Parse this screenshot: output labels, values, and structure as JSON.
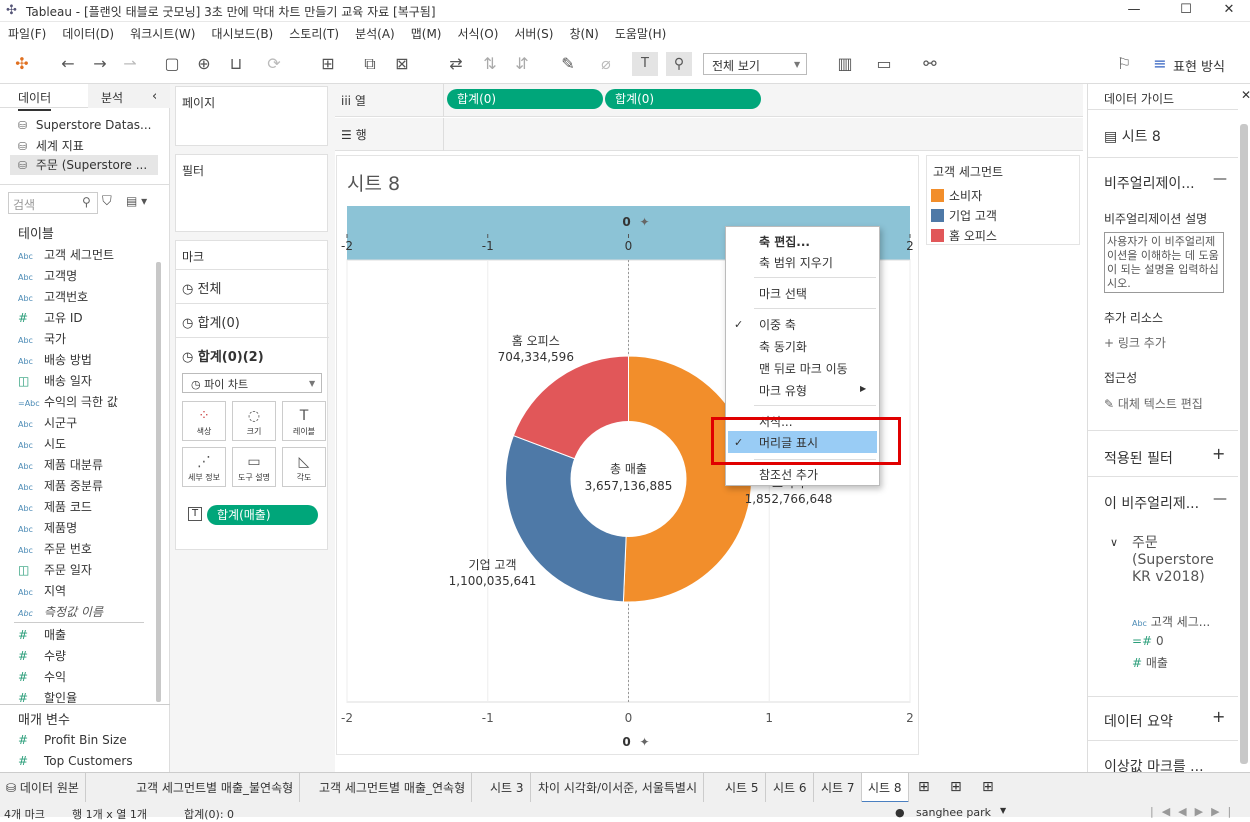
{
  "window": {
    "title": "Tableau - [플랜잇 태블로 굿모닝] 3초 만에 막대 차트 만들기 교육 자료 [복구됨]"
  },
  "menubar": [
    "파일(F)",
    "데이터(D)",
    "워크시트(W)",
    "대시보드(B)",
    "스토리(T)",
    "분석(A)",
    "맵(M)",
    "서식(O)",
    "서버(S)",
    "창(N)",
    "도움말(H)"
  ],
  "toolbar": {
    "view_select": "전체 보기",
    "show_me": "표현 방식"
  },
  "left": {
    "tab_data": "데이터",
    "tab_analysis": "분석",
    "datasources": [
      "Superstore Datas...",
      "세계 지표",
      "주문 (Superstore ..."
    ],
    "search_placeholder": "검색",
    "tables_header": "테이블",
    "dimensions": [
      {
        "type": "Abc",
        "name": "고객 세그먼트"
      },
      {
        "type": "Abc",
        "name": "고객명"
      },
      {
        "type": "Abc",
        "name": "고객번호"
      },
      {
        "type": "#",
        "name": "고유 ID"
      },
      {
        "type": "Abc",
        "name": "국가"
      },
      {
        "type": "Abc",
        "name": "배송 방법"
      },
      {
        "type": "date",
        "name": "배송 일자"
      },
      {
        "type": "=Abc",
        "name": "수익의 극한 값"
      },
      {
        "type": "Abc",
        "name": "시군구"
      },
      {
        "type": "Abc",
        "name": "시도"
      },
      {
        "type": "Abc",
        "name": "제품 대분류"
      },
      {
        "type": "Abc",
        "name": "제품 중분류"
      },
      {
        "type": "Abc",
        "name": "제품 코드"
      },
      {
        "type": "Abc",
        "name": "제품명"
      },
      {
        "type": "Abc",
        "name": "주문 번호"
      },
      {
        "type": "date",
        "name": "주문 일자"
      },
      {
        "type": "Abc",
        "name": "지역"
      },
      {
        "type": "Abc",
        "name": "측정값 이름"
      }
    ],
    "measures": [
      "매출",
      "수량",
      "수익",
      "할인율"
    ],
    "params_header": "매개 변수",
    "params": [
      "Profit Bin Size",
      "Top Customers"
    ]
  },
  "shelves": {
    "pages": "페이지",
    "filters": "필터",
    "marks": "마크",
    "marks_all": "전체",
    "marks_sum0": "합계(0)",
    "marks_sum02": "합계(0)(2)",
    "mark_type": "파이 차트",
    "mark_buttons": [
      "색상",
      "크기",
      "레이블",
      "세부 정보",
      "도구 설명",
      "각도"
    ],
    "mark_pill": "합계(매출)",
    "columns_label": "열",
    "rows_label": "행",
    "col_pills": [
      "합계(0)",
      "합계(0)"
    ]
  },
  "viz": {
    "sheet_title": "시트 8",
    "axis_ticks": [
      "-2",
      "-1",
      "0",
      "1",
      "2"
    ],
    "axis_title": "0",
    "center_label": "총 매출",
    "center_value": "3,657,136,885"
  },
  "chart_data": {
    "type": "pie",
    "title": "시트 8",
    "categories": [
      "소비자",
      "기업 고객",
      "홈 오피스"
    ],
    "values": [
      1852766648,
      1100035641,
      704334596
    ],
    "labels": [
      "1,852,766,648",
      "1,100,035,641",
      "704,334,596"
    ],
    "colors": [
      "#f28e2b",
      "#4e79a7",
      "#e15759"
    ],
    "total": 3657136885,
    "xlim": [
      -2,
      2
    ],
    "legend": "right"
  },
  "legend": {
    "title": "고객 세그먼트",
    "items": [
      {
        "name": "소비자",
        "color": "#f28e2b"
      },
      {
        "name": "기업 고객",
        "color": "#4e79a7"
      },
      {
        "name": "홈 오피스",
        "color": "#e15759"
      }
    ]
  },
  "context_menu": {
    "items": [
      "축 편집...",
      "축 범위 지우기",
      "마크 선택",
      "이중 축",
      "축 동기화",
      "맨 뒤로 마크 이동",
      "마크 유형",
      "서식...",
      "머리글 표시",
      "참조선 추가"
    ],
    "checked": [
      "이중 축",
      "머리글 표시"
    ],
    "highlighted": "머리글 표시"
  },
  "guide": {
    "header": "데이터 가이드",
    "sheet": "시트 8",
    "viz_section": "비주얼리제이...",
    "desc_label": "비주얼리제이션 설명",
    "desc_placeholder": "사용자가 이 비주얼리제이션을 이해하는 데 도움이 되는 설명을 입력하십시오.",
    "resources": "추가 리소스",
    "add_link": "링크 추가",
    "access": "접근성",
    "alt_text": "대체 텍스트 편집",
    "filters": "적용된 필터",
    "this_viz": "이 비주얼리제...",
    "ds": "주문 (Superstore KR v2018)",
    "fields": [
      "고객 세그...",
      "0",
      "매출"
    ],
    "summary": "데이터 요약",
    "outliers": "이상값 마크를 ..."
  },
  "tabs": [
    "데이터 원본",
    "고객 세그먼트별 매출_불연속형",
    "고객 세그먼트별 매출_연속형",
    "시트 3",
    "차이 시각화/이서준, 서울특별시",
    "시트 5",
    "시트 6",
    "시트 7",
    "시트 8"
  ],
  "status": {
    "marks": "4개 마크",
    "rows_cols": "행 1개 x 열 1개",
    "sum": "합계(0): 0",
    "user": "sanghee park"
  }
}
